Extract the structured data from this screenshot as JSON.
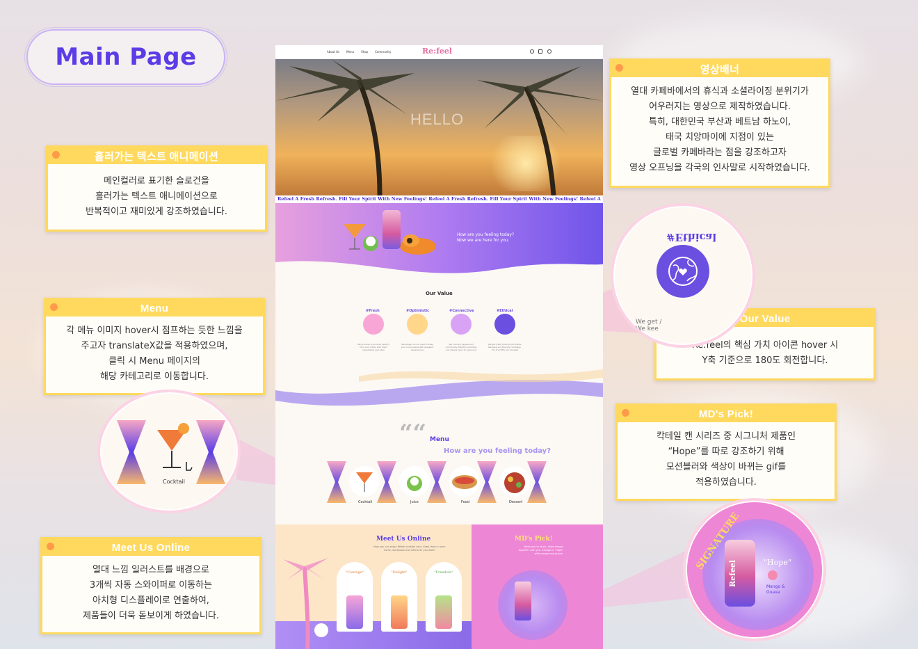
{
  "page_title": "Main Page",
  "site": {
    "nav_links": [
      "About Us",
      "Menu",
      "Shop",
      "Community"
    ],
    "logo": "Re:feel",
    "hero_text": "HELLO",
    "marquee": "Refeel A Fresh Refresh. Fill Your Spirit With New Feelings!   Refeel A Fresh Refresh. Fill Your Spirit With New Feelings!   Refeel A Fresh Refresh. Fill Your Spirit With New Feelings!",
    "banner_question": "How are you feeling today?",
    "banner_answer": "Now we are here for you.",
    "can_brand": "Refeel",
    "our_value_title": "Our Value",
    "values": [
      {
        "tag": "#Fresh",
        "text": "We promise to provide healthy food and drinks with fresh ingredients everyday",
        "color": "#f7a6d6"
      },
      {
        "tag": "#Optimistic",
        "text": "We always do our best to keep your inner peace with pleasant experiences",
        "color": "#ffd68a"
      },
      {
        "tag": "#Connective",
        "text": "We connect people and community. Monthly activities are always open to everyone",
        "color": "#d9a3f5"
      },
      {
        "tag": "#Ethical",
        "text": "We get fresh fruits by fair trade. We keep eco-friendly campaign. 5% of profits are donated",
        "color": "#6a4fe0"
      }
    ],
    "quote_mark": "““",
    "menu_title": "Menu",
    "menu_subtitle": "How are you feeling today?",
    "menu_items": [
      "Cocktail",
      "Juice",
      "Food",
      "Dessert"
    ],
    "meet_title": "Meet Us Online",
    "meet_sub": "Now you can enjoy Refeel cocktail cans. Keep them in your home, workplace and wherever you want!",
    "products": [
      {
        "name": "\"Courage\"",
        "flavor": "Dragonfruit & Mango"
      },
      {
        "name": "\"Delight\"",
        "flavor": "Orange & Lemon"
      },
      {
        "name": "\"Freedom\"",
        "flavor": "Watermelon"
      }
    ],
    "mds_title": "MD's Pick!",
    "mds_sub": "While you're stuck, Hope always together with you. Indulge in \"Hope\" with mango and guava.",
    "signature": "SIGNATURE",
    "hope_name": "\"Hope\"",
    "hope_flavor": "Mango & Guava"
  },
  "cards": {
    "video": {
      "title": "영상배너",
      "lines": [
        "열대 카페바에서의 휴식과 소셜라이징 분위기가",
        "어우러지는 영상으로 제작하였습니다.",
        "특히, 대한민국 부산과 베트남 하노이,",
        "태국 치앙마이에 지점이 있는",
        "글로벌 카페바라는 점을 강조하고자",
        "영상 오프닝을 각국의 인사말로 시작하였습니다."
      ]
    },
    "marquee": {
      "title": "흘러가는 텍스트 애니메이션",
      "lines": [
        "메인컬러로 표기한 슬로건을",
        "흘러가는 텍스트 애니메이션으로",
        "반복적이고 재미있게 강조하였습니다."
      ]
    },
    "menu": {
      "title": "Menu",
      "lines": [
        "각 메뉴 이미지 hover시 점프하는 듯한 느낌을",
        "주고자 translateX값을 적용하였으며,",
        "클릭 시 Menu 페이지의",
        "해당 카테고리로 이동합니다."
      ]
    },
    "value": {
      "title": "Our Value",
      "lines": [
        "Re:feel의 핵심 가치 아이콘 hover 시",
        "Y축 기준으로 180도 회전합니다."
      ]
    },
    "mds": {
      "title": "MD's Pick!",
      "lines": [
        "칵테일 캔 시리즈 중 시그니처 제품인",
        "“Hope”를 따로 강조하기 위해",
        "모션블러와 색상이 바뀌는 gif를",
        "적용하였습니다."
      ]
    },
    "meet": {
      "title": "Meet Us Online",
      "lines": [
        "열대 느낌 일러스트를 배경으로",
        "3개씩 자동 스와이퍼로 이동하는",
        "아치형 디스플레이로 연출하여,",
        "제품들이 더욱 돋보이게 하였습니다."
      ]
    }
  },
  "zoom": {
    "ethical_mirror": "#Ethical",
    "ethical_snippet": "We get / We kee",
    "menu_label": "Cocktail"
  },
  "colors": {
    "accent": "#5a3de6",
    "card_border": "#ffd95e",
    "card_dot": "#ff9a4a",
    "pink": "#ee86d6"
  }
}
